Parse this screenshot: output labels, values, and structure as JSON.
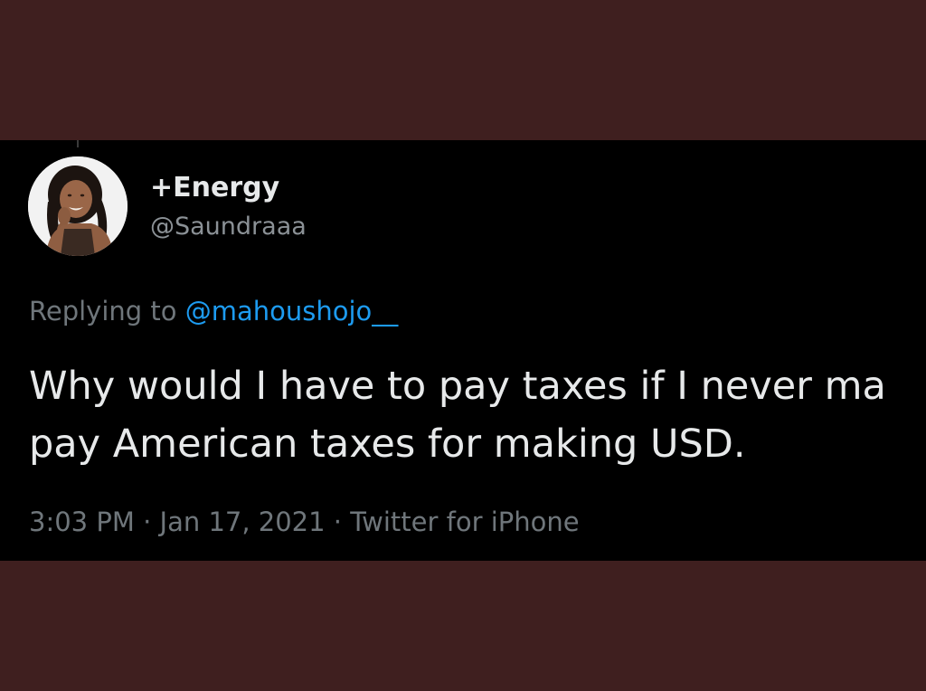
{
  "tweet": {
    "display_name": "+Energy",
    "handle": "@Saundraaa",
    "replying_prefix": "Replying to",
    "replying_to": "@mahoushojo__",
    "text_line_1": "Why would I have to pay taxes if I never ma",
    "text_line_2": "pay American taxes for making USD.",
    "time": "3:03 PM",
    "date": "Jan 17, 2021",
    "source": "Twitter for iPhone",
    "separator": " · "
  },
  "colors": {
    "page_background": "#3f1f1f",
    "card_background": "#000000",
    "primary_text": "#e7e9ea",
    "secondary_text": "#6f767b",
    "link": "#1d9bf0"
  }
}
